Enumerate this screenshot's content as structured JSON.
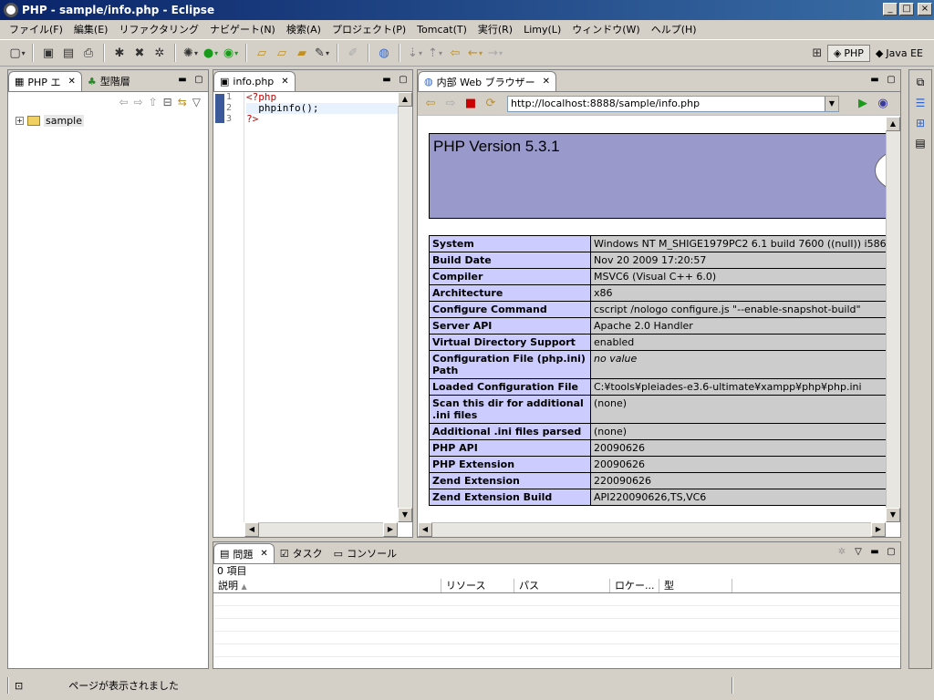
{
  "window": {
    "title": "PHP - sample/info.php - Eclipse",
    "controls": [
      "_",
      "□",
      "×"
    ]
  },
  "menu": [
    "ファイル(F)",
    "編集(E)",
    "リファクタリング",
    "ナビゲート(N)",
    "検索(A)",
    "プロジェクト(P)",
    "Tomcat(T)",
    "実行(R)",
    "Limy(L)",
    "ウィンドウ(W)",
    "ヘルプ(H)"
  ],
  "perspectives": [
    {
      "label": "PHP",
      "active": true
    },
    {
      "label": "Java EE",
      "active": false
    }
  ],
  "explorer": {
    "tabs": [
      {
        "label": "PHP エ",
        "active": true
      },
      {
        "label": "型階層",
        "active": false
      }
    ],
    "tree": [
      {
        "label": "sample",
        "expand": "+"
      }
    ]
  },
  "editor": {
    "tab": "info.php",
    "line_numbers": [
      "1",
      "2",
      "3"
    ],
    "lines": [
      "<?php",
      "  phpinfo();",
      "?>"
    ]
  },
  "browser": {
    "tab": "内部 Web ブラウザー",
    "url": "http://localhost:8888/sample/info.php",
    "php_version": "PHP Version 5.3.1",
    "rows": [
      {
        "key": "System",
        "value": "Windows NT M_SHIGE1979PC2 6.1 build 7600 ((null)) i586"
      },
      {
        "key": "Build Date",
        "value": "Nov 20 2009 17:20:57"
      },
      {
        "key": "Compiler",
        "value": "MSVC6 (Visual C++ 6.0)"
      },
      {
        "key": "Architecture",
        "value": "x86"
      },
      {
        "key": "Configure Command",
        "value": "cscript /nologo configure.js \"--enable-snapshot-build\""
      },
      {
        "key": "Server API",
        "value": "Apache 2.0 Handler"
      },
      {
        "key": "Virtual Directory Support",
        "value": "enabled"
      },
      {
        "key": "Configuration File (php.ini) Path",
        "value": "no value"
      },
      {
        "key": "Loaded Configuration File",
        "value": "C:¥tools¥pleiades-e3.6-ultimate¥xampp¥php¥php.ini"
      },
      {
        "key": "Scan this dir for additional .ini files",
        "value": "(none)"
      },
      {
        "key": "Additional .ini files parsed",
        "value": "(none)"
      },
      {
        "key": "PHP API",
        "value": "20090626"
      },
      {
        "key": "PHP Extension",
        "value": "20090626"
      },
      {
        "key": "Zend Extension",
        "value": "220090626"
      },
      {
        "key": "Zend Extension Build",
        "value": "API220090626,TS,VC6"
      }
    ]
  },
  "problems": {
    "tabs": [
      {
        "label": "問題",
        "active": true
      },
      {
        "label": "タスク",
        "active": false
      },
      {
        "label": "コンソール",
        "active": false
      }
    ],
    "count": "0 項目",
    "columns": [
      "説明",
      "リソース",
      "パス",
      "ロケー...",
      "型"
    ]
  },
  "status": {
    "message": "ページが表示されました"
  }
}
